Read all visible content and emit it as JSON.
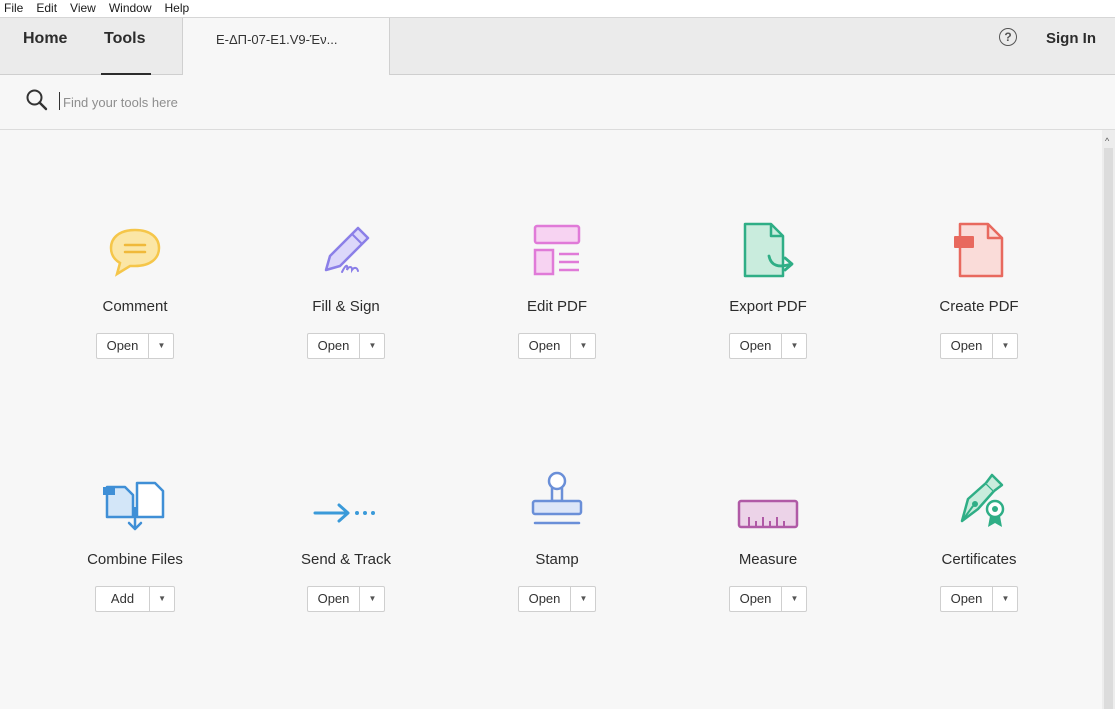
{
  "menu": [
    "File",
    "Edit",
    "View",
    "Window",
    "Help"
  ],
  "nav": {
    "home": "Home",
    "tools": "Tools"
  },
  "document_tab": "Ε-ΔΠ-07-Ε1.V9-Έν...",
  "help_glyph": "?",
  "sign_in": "Sign In",
  "search": {
    "placeholder": "Find your tools here"
  },
  "tools": [
    {
      "name": "Comment",
      "action": "Open",
      "icon": "comment-icon",
      "color": "#f5c64a"
    },
    {
      "name": "Fill & Sign",
      "action": "Open",
      "icon": "fill-sign-icon",
      "color": "#8b7fe8"
    },
    {
      "name": "Edit PDF",
      "action": "Open",
      "icon": "edit-pdf-icon",
      "color": "#e07ad8"
    },
    {
      "name": "Export PDF",
      "action": "Open",
      "icon": "export-pdf-icon",
      "color": "#2fae86"
    },
    {
      "name": "Create PDF",
      "action": "Open",
      "icon": "create-pdf-icon",
      "color": "#e8695e"
    },
    {
      "name": "Combine Files",
      "action": "Add",
      "icon": "combine-files-icon",
      "color": "#3f8fd6"
    },
    {
      "name": "Send & Track",
      "action": "Open",
      "icon": "send-track-icon",
      "color": "#3a9ad9"
    },
    {
      "name": "Stamp",
      "action": "Open",
      "icon": "stamp-icon",
      "color": "#6a8fd8"
    },
    {
      "name": "Measure",
      "action": "Open",
      "icon": "measure-icon",
      "color": "#b05aa6"
    },
    {
      "name": "Certificates",
      "action": "Open",
      "icon": "certificates-icon",
      "color": "#2fae86"
    }
  ]
}
